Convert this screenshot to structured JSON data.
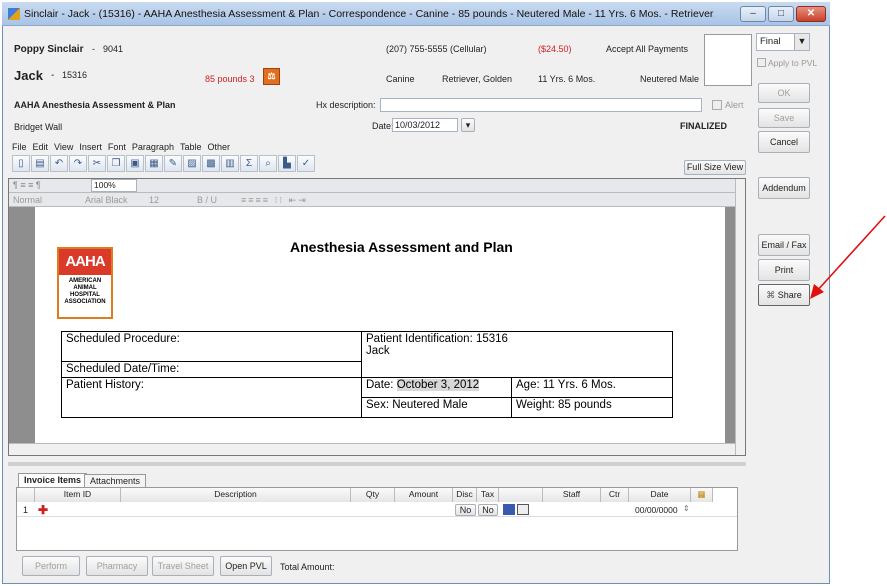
{
  "window": {
    "title": "Sinclair - Jack - (15316) - AAHA Anesthesia Assessment & Plan - Correspondence - Canine - 85 pounds - Neutered Male - 11 Yrs. 6 Mos. - Retriever, Golden (Fin...",
    "min": "–",
    "max": "□",
    "close": "✕"
  },
  "client": {
    "name": "Poppy Sinclair",
    "sep": "-",
    "id": "9041",
    "phone": "(207) 755-5555 (Cellular)",
    "balance": "($24.50)",
    "payments": "Accept All Payments"
  },
  "patient": {
    "name": "Jack",
    "sep": "-",
    "id": "15316",
    "weight": "85 pounds 3",
    "species": "Canine",
    "breed": "Retriever, Golden",
    "age": "11 Yrs. 6 Mos.",
    "sex": "Neutered Male"
  },
  "document": {
    "name": "AAHA Anesthesia Assessment & Plan",
    "author": "Bridget Wall",
    "hx_label": "Hx description:",
    "hx_value": "",
    "alert": "Alert",
    "date_label": "Date:",
    "date_value": "10/03/2012",
    "status": "FINALIZED"
  },
  "right_panel": {
    "status_select": "Final",
    "apply_to_pvl": "Apply to PVL",
    "ok": "OK",
    "save": "Save",
    "cancel": "Cancel",
    "addendum": "Addendum",
    "email_fax": "Email / Fax",
    "print": "Print",
    "share": "Share"
  },
  "menu": [
    "File",
    "Edit",
    "View",
    "Insert",
    "Font",
    "Paragraph",
    "Table",
    "Other"
  ],
  "full_size_view": "Full Size View",
  "editor": {
    "zoom": "100%",
    "style": "Normal",
    "font": "Arial Black",
    "size": "12",
    "format_letters": "B / U"
  },
  "logo": {
    "big": "AAHA",
    "small": "AMERICAN ANIMAL HOSPITAL ASSOCIATION"
  },
  "form": {
    "heading": "Anesthesia Assessment and Plan",
    "scheduled_procedure": "Scheduled Procedure:",
    "scheduled_datetime": "Scheduled Date/Time:",
    "patient_history": "Patient History:",
    "patient_identification": "Patient Identification:",
    "patient_id_value": "15316",
    "patient_name_value": "Jack",
    "date_prefix": "Date:",
    "date_value": "October 3, 2012",
    "age": "Age: 11 Yrs. 6 Mos.",
    "sex": "Sex: Neutered Male",
    "weight": "Weight: 85 pounds"
  },
  "invoice": {
    "tabs": [
      "Invoice Items",
      "Attachments"
    ],
    "columns": [
      "Item ID",
      "Description",
      "Qty",
      "Amount",
      "Disc",
      "Tax",
      "",
      "Staff",
      "Ctr",
      "Date"
    ],
    "row": {
      "num": "1",
      "disc": "No",
      "tax": "No",
      "date": "00/00/0000"
    }
  },
  "footer": {
    "perform": "Perform",
    "pharmacy": "Pharmacy",
    "travel_sheet": "Travel Sheet",
    "open_pvl": "Open PVL",
    "total_amount": "Total Amount:"
  },
  "colors": {
    "arrow": "#e01010",
    "aaha_orange": "#e07a20",
    "weight_red": "#d02020"
  }
}
